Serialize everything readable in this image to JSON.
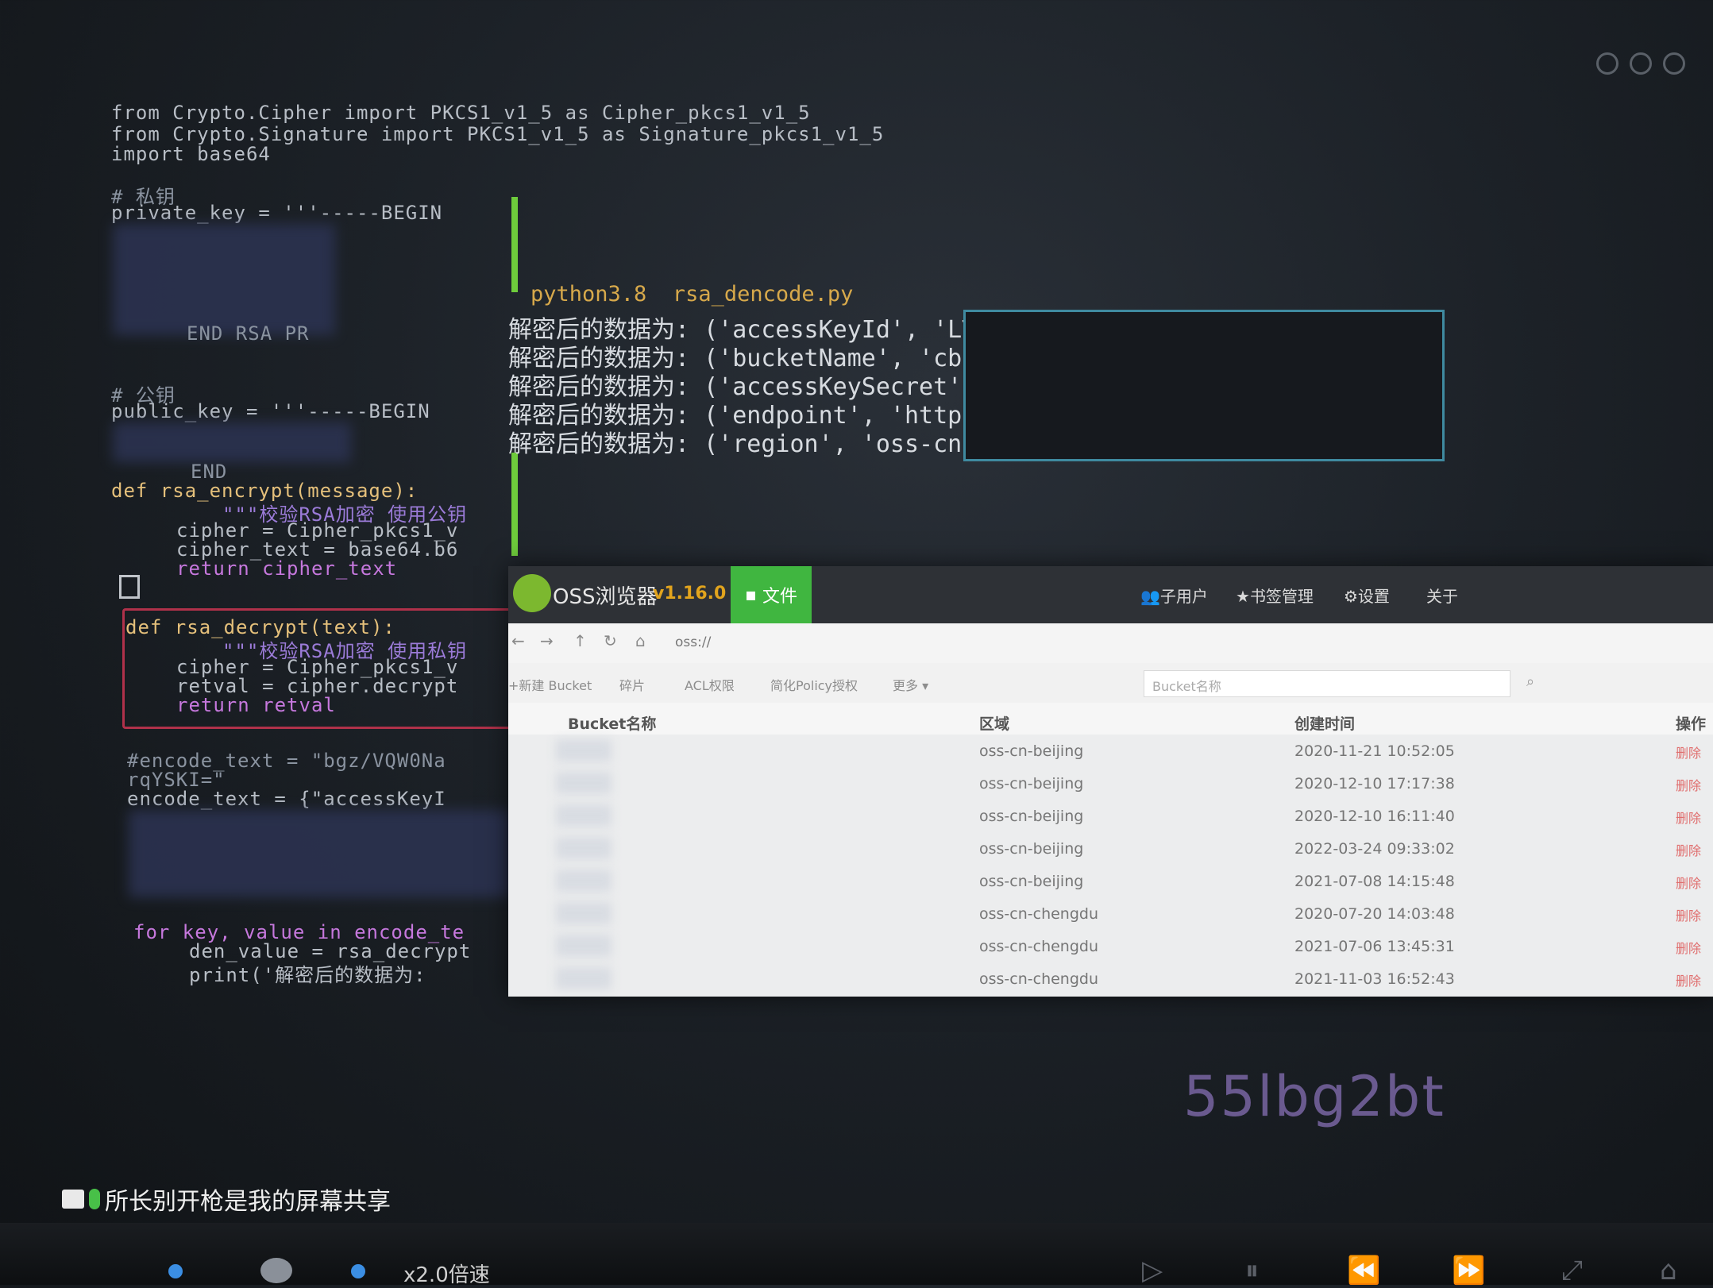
{
  "editor": {
    "imports": [
      "from Crypto.Cipher import PKCS1_v1_5 as Cipher_pkcs1_v1_5",
      "from Crypto.Signature import PKCS1_v1_5 as Signature_pkcs1_v1_5",
      "import base64"
    ],
    "private_comment": "# 私钥",
    "private_key_line": "private_key = '''-----BEGIN",
    "private_end": "END RSA PR",
    "public_comment": "# 公钥",
    "public_key_line": "public_key = '''-----BEGIN",
    "public_end": "END",
    "encrypt_def": "def rsa_encrypt(message):",
    "encrypt_doc": "\"\"\"校验RSA加密 使用公钥",
    "encrypt_cipher": "cipher = Cipher_pkcs1_v",
    "encrypt_text": "cipher_text = base64.b6",
    "encrypt_return": "return cipher_text",
    "decrypt_def": "def rsa_decrypt(text):",
    "decrypt_doc": "\"\"\"校验RSA加密 使用私钥",
    "decrypt_cipher": "cipher = Cipher_pkcs1_v",
    "decrypt_retval": "retval = cipher.decrypt",
    "decrypt_return": "return retval",
    "encode_comment": "#encode_text = \"bgz/VQW0Na",
    "encode_comment2": "rqYSKI=\"",
    "encode_text": "encode_text = {\"accessKeyI",
    "for_line": "for key, value in encode_te",
    "den_line": "den_value = rsa_decrypt",
    "print_line": "print('解密后的数据为:"
  },
  "terminal": {
    "command": "python3.8  rsa_dencode.py",
    "outputs": [
      "解密后的数据为: ('accessKeyId', 'LTA",
      "解密后的数据为: ('bucketName', 'cbi-",
      "解密后的数据为: ('accessKeySecret',",
      "解密后的数据为: ('endpoint', 'https:",
      "解密后的数据为: ('region', 'oss-cn-b"
    ]
  },
  "oss": {
    "app_name": "OSS浏览器",
    "version": "v1.16.0",
    "files_tab": "文件",
    "nav": [
      "子用户",
      "书签管理",
      "设置",
      "关于"
    ],
    "address": "oss://",
    "toolbar": [
      "+新建 Bucket",
      "碎片",
      "ACL权限",
      "简化Policy授权",
      "更多"
    ],
    "search_placeholder": "Bucket名称",
    "columns": [
      "Bucket名称",
      "区域",
      "创建时间",
      "操作"
    ],
    "rows": [
      {
        "region": "oss-cn-beijing",
        "created": "2020-11-21 10:52:05",
        "action": "删除"
      },
      {
        "region": "oss-cn-beijing",
        "created": "2020-12-10 17:17:38",
        "action": "删除"
      },
      {
        "region": "oss-cn-beijing",
        "created": "2020-12-10 16:11:40",
        "action": "删除"
      },
      {
        "region": "oss-cn-beijing",
        "created": "2022-03-24 09:33:02",
        "action": "删除"
      },
      {
        "region": "oss-cn-beijing",
        "created": "2021-07-08 14:15:48",
        "action": "删除"
      },
      {
        "region": "oss-cn-chengdu",
        "created": "2020-07-20 14:03:48",
        "action": "删除"
      },
      {
        "region": "oss-cn-chengdu",
        "created": "2021-07-06 13:45:31",
        "action": "删除"
      },
      {
        "region": "oss-cn-chengdu",
        "created": "2021-11-03 16:52:43",
        "action": "删除"
      }
    ]
  },
  "overlay": {
    "watermark": "55lbg2bt",
    "share_text": "所长别开枪是我的屏幕共享",
    "speed": "x2.0倍速"
  }
}
